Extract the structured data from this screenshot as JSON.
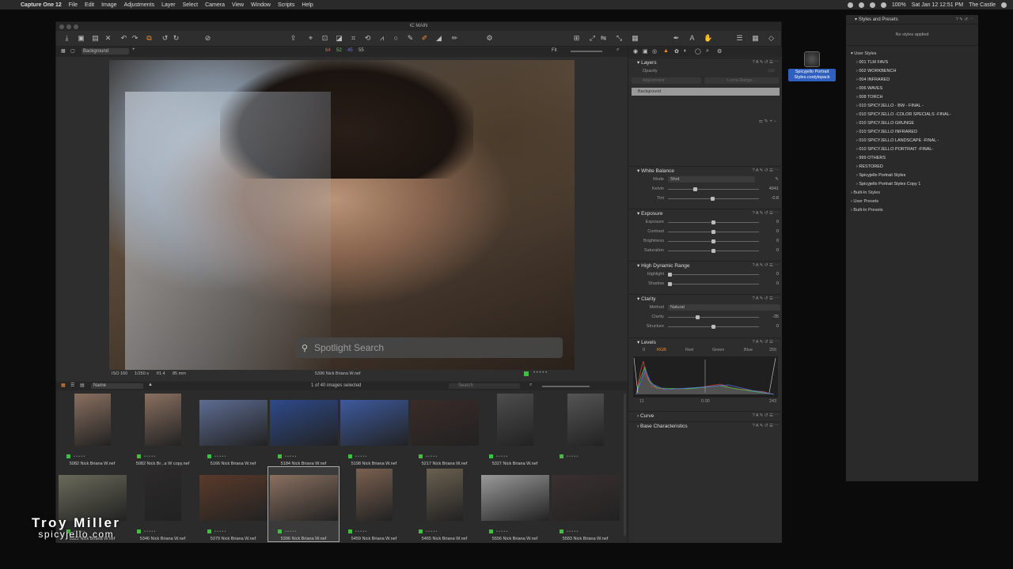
{
  "menubar": {
    "app": "Capture One 12",
    "items": [
      "File",
      "Edit",
      "Image",
      "Adjustments",
      "Layer",
      "Select",
      "Camera",
      "View",
      "Window",
      "Scripts",
      "Help"
    ],
    "battery": "100%",
    "datetime": "Sat Jan 12  12:51 PM",
    "location": "The Castle"
  },
  "window": {
    "title": "IC MAIN"
  },
  "viewer_subbar": {
    "layer": "Background",
    "values": [
      "64",
      "52",
      "45",
      "55"
    ],
    "fit": "Fit"
  },
  "viewer": {
    "spotlight_placeholder": "Spotlight Search",
    "iso": "ISO 160",
    "shutter": "1/250 s",
    "aperture": "f/1.4",
    "focal": "85 mm",
    "filename": "5396 Nick Briana W.nef"
  },
  "browser_bar": {
    "sort": "Name",
    "selected": "1 of 40 images selected",
    "search_placeholder": "Search"
  },
  "thumbnails": [
    {
      "name": "5082 Nick Briana W.nef",
      "color": "#8a7060",
      "w": 46,
      "h": 66
    },
    {
      "name": "5082 Nick Br...a W copy.nef",
      "color": "#8a7060",
      "w": 46,
      "h": 66
    },
    {
      "name": "5166 Nick Briana W.nef",
      "color": "#5d6c92",
      "w": 86,
      "h": 58
    },
    {
      "name": "5184 Nick Briana W.nef",
      "color": "#2e4a8a",
      "w": 86,
      "h": 58
    },
    {
      "name": "5198 Nick Briana W.nef",
      "color": "#3d5a9e",
      "w": 86,
      "h": 58
    },
    {
      "name": "5217 Nick Briana W.nef",
      "color": "#3a2b28",
      "w": 86,
      "h": 58
    },
    {
      "name": "5327 Nick Briana W.nef",
      "color": "#4d4d4d",
      "w": 46,
      "h": 66
    },
    {
      "name": "",
      "color": "#555555",
      "w": 46,
      "h": 66
    },
    {
      "name": "5322 Nick Briana W.nef",
      "color": "#6a6a5a",
      "w": 86,
      "h": 58
    },
    {
      "name": "5346 Nick Briana W.nef",
      "color": "#2c2a2a",
      "w": 46,
      "h": 66
    },
    {
      "name": "5379 Nick Briana W.nef",
      "color": "#5a3a2a",
      "w": 86,
      "h": 58
    },
    {
      "name": "5396 Nick Briana W.nef",
      "color": "#8a7060",
      "w": 86,
      "h": 58
    },
    {
      "name": "5459 Nick Briana W.nef",
      "color": "#7a6050",
      "w": 46,
      "h": 66
    },
    {
      "name": "5465 Nick Briana W.nef",
      "color": "#6a6050",
      "w": 46,
      "h": 66
    },
    {
      "name": "5556 Nick Briana W.nef",
      "color": "#9a9a9a",
      "w": 86,
      "h": 58
    },
    {
      "name": "5583 Nick Briana W.nef",
      "color": "#3a3030",
      "w": 86,
      "h": 58
    }
  ],
  "tools": {
    "layers": {
      "title": "Layers",
      "opacity": "Opacity",
      "opacity_val": "100",
      "adjustment": "Adjustment",
      "luma": "Luma Range...",
      "background": "Background"
    },
    "white_balance": {
      "title": "White Balance",
      "mode_label": "Mode",
      "mode": "Shot",
      "kelvin_label": "Kelvin",
      "kelvin": "4941",
      "tint_label": "Tint",
      "tint": "-0.8"
    },
    "exposure": {
      "title": "Exposure",
      "rows": [
        {
          "label": "Exposure",
          "val": "0"
        },
        {
          "label": "Contrast",
          "val": "0"
        },
        {
          "label": "Brightness",
          "val": "0"
        },
        {
          "label": "Saturation",
          "val": "0"
        }
      ]
    },
    "hdr": {
      "title": "High Dynamic Range",
      "rows": [
        {
          "label": "Highlight",
          "val": "0"
        },
        {
          "label": "Shadow",
          "val": "0"
        }
      ]
    },
    "clarity": {
      "title": "Clarity",
      "method_label": "Method",
      "method": "Natural",
      "rows": [
        {
          "label": "Clarity",
          "val": "-35"
        },
        {
          "label": "Structure",
          "val": "0"
        }
      ]
    },
    "levels": {
      "title": "Levels",
      "channels": [
        "0",
        "RGB",
        "Red",
        "Green",
        "Blue",
        "255"
      ],
      "low": "11",
      "mid": "0.00",
      "high": "243"
    },
    "curve": {
      "title": "Curve"
    },
    "base": {
      "title": "Base Characteristics"
    }
  },
  "presets": {
    "header": "Styles and Presets",
    "none": "No styles applied",
    "user_styles": "User Styles",
    "items": [
      "001  TLM FAVS",
      "002  WORKBENCH",
      "004  INFRARED",
      "006  WAVES",
      "008  TORCH",
      "010  SPICYJELLO - BW  - FINAL -",
      "010  SPICYJELLO -COLOR SPECIALS -FINAL-",
      "010  SPICYJELLO GRUNGE",
      "010  SPICYJELLO INFRARED",
      "010  SPICYJELLO LANDSCAPE  -FINAL -",
      "010  SPICYJELLO PORTRAIT -FINAL-",
      "999  OTHERS",
      "RESTORED",
      "Spicyjello Portrait Styles",
      "Spicyjello Portrait Styles Copy 1"
    ],
    "built_in_styles": "Built-In Styles",
    "user_presets": "User Presets",
    "built_in_presets": "Built-In Presets"
  },
  "desktop": {
    "file": "Spicyjello Portrait Styles.costylepack"
  },
  "watermark": {
    "name": "Troy Miller",
    "site": "spicyjello.com"
  }
}
